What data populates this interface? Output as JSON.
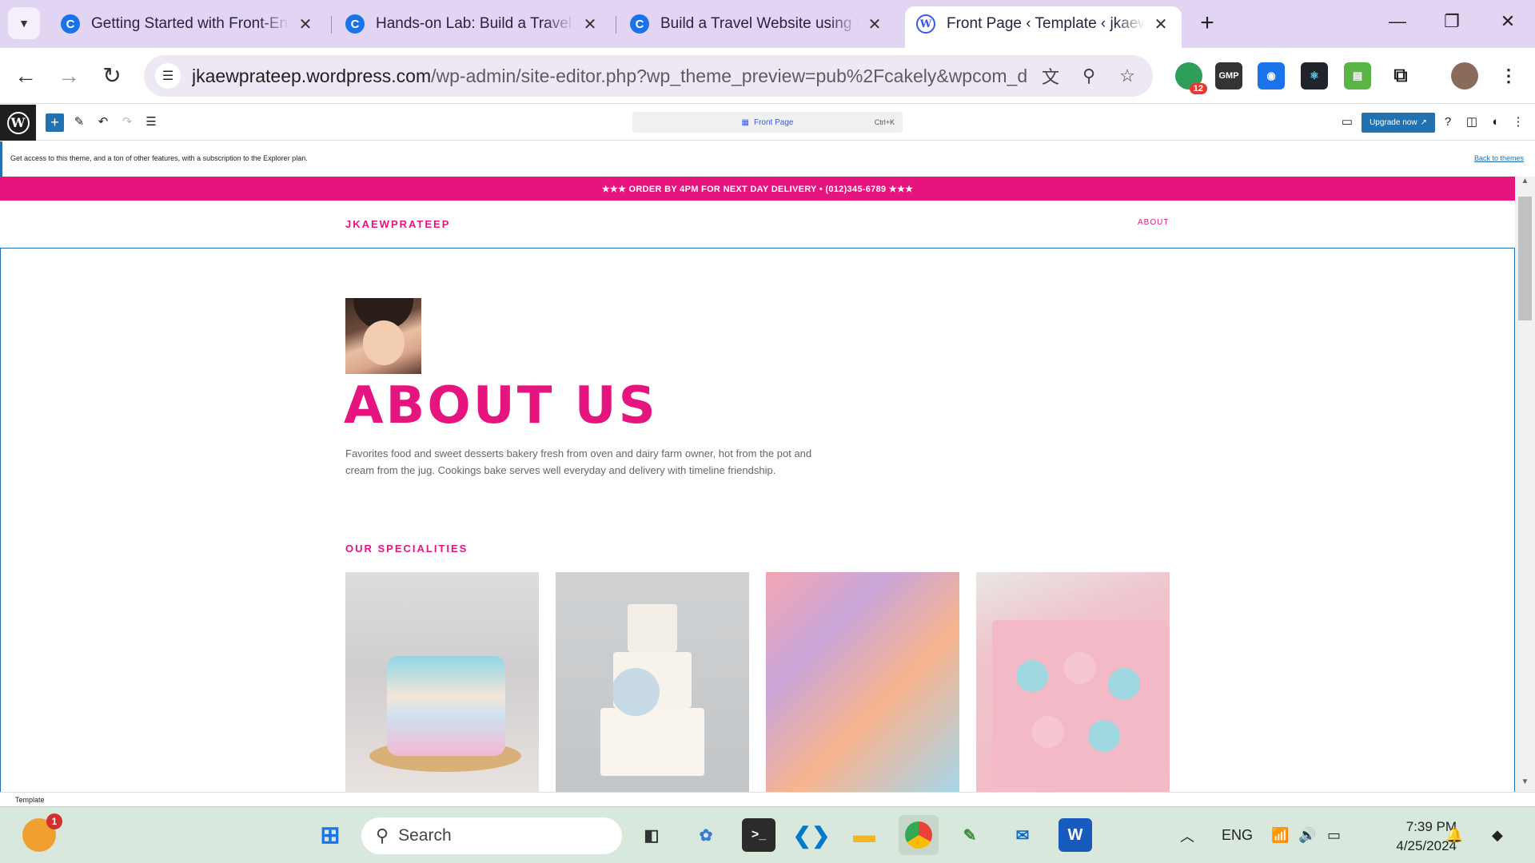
{
  "browser": {
    "tabs": [
      {
        "title": "Getting Started with Front-End",
        "favicon": "c-icon",
        "active": false
      },
      {
        "title": "Hands-on Lab: Build a Travel We",
        "favicon": "c-icon",
        "active": false
      },
      {
        "title": "Build a Travel Website using Wo",
        "favicon": "c-icon",
        "active": false
      },
      {
        "title": "Front Page ‹ Template ‹ jkaewpr",
        "favicon": "wordpress-icon",
        "active": true
      }
    ],
    "url_host": "jkaewprateep.wordpress.com",
    "url_path": "/wp-admin/site-editor.php?wp_theme_preview=pub%2Fcakely&wpcom_dashboar...",
    "extension_badge": "12",
    "extension_gmp": "GMP"
  },
  "editor": {
    "command_label": "Front Page",
    "command_shortcut": "Ctrl+K",
    "upgrade_label": "Upgrade now",
    "notice_text": "Get access to this theme, and a ton of other features, with a subscription to the Explorer plan.",
    "back_link": "Back to themes",
    "footer_label": "Template"
  },
  "site": {
    "promo": "★★★ ORDER BY 4PM FOR NEXT DAY DELIVERY • (012)345-6789 ★★★",
    "title": "JKAEWPRATEEP",
    "nav": "ABOUT",
    "heading": "ABOUT US",
    "paragraph": "Favorites food and sweet desserts bakery fresh from oven and dairy farm owner, hot from the pot and cream from the jug. Cookings bake serves well everyday and delivery with timeline friendship.",
    "specialities_heading": "OUR SPECIALITIES",
    "specialities": [
      "cake-image",
      "wedding-cake-image",
      "macarons-image",
      "cupcakes-image"
    ]
  },
  "taskbar": {
    "search_placeholder": "Search",
    "notification_badge": "1",
    "language": "ENG",
    "time": "7:39 PM",
    "date": "4/25/2024"
  },
  "colors": {
    "accent": "#e6147f",
    "wp_blue": "#2271b1",
    "tabstrip": "#e2d4f3"
  }
}
